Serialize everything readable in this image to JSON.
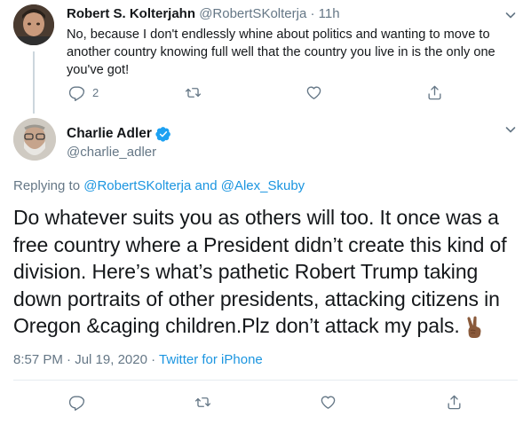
{
  "reply_tweet": {
    "display_name": "Robert S. Kolterjahn",
    "handle": "@RobertSKolterja",
    "separator": "·",
    "time_ago": "11h",
    "text": "No, because I don't endlessly whine about politics and wanting to move to another country knowing full well that the country you live in is the only one you've got!",
    "reply_count": "2",
    "icons": [
      "reply-icon",
      "retweet-icon",
      "like-icon",
      "share-icon"
    ]
  },
  "main_tweet": {
    "display_name": "Charlie Adler",
    "handle": "@charlie_adler",
    "verified": true,
    "replying_prefix": "Replying to",
    "replying_user_1": "@RobertSKolterja",
    "replying_and": "and",
    "replying_user_2": "@Alex_Skuby",
    "text": "Do whatever suits you as others will too. It once was a free country where a President didn’t create this kind of division. Here’s what’s pathetic Robert Trump taking down portraits of other presidents, attacking citizens in Oregon &caging children.Plz don’t attack my pals.",
    "time": "8:57 PM",
    "date_separator": "·",
    "date": "Jul 19, 2020",
    "source_separator": "·",
    "source": "Twitter for iPhone",
    "emoji": "victory-hand-medium-dark-skin-tone"
  },
  "colors": {
    "text": "#14171a",
    "secondary": "#657786",
    "link": "#1b95e0",
    "verified": "#1da1f2",
    "divider": "#e6ecf0"
  }
}
